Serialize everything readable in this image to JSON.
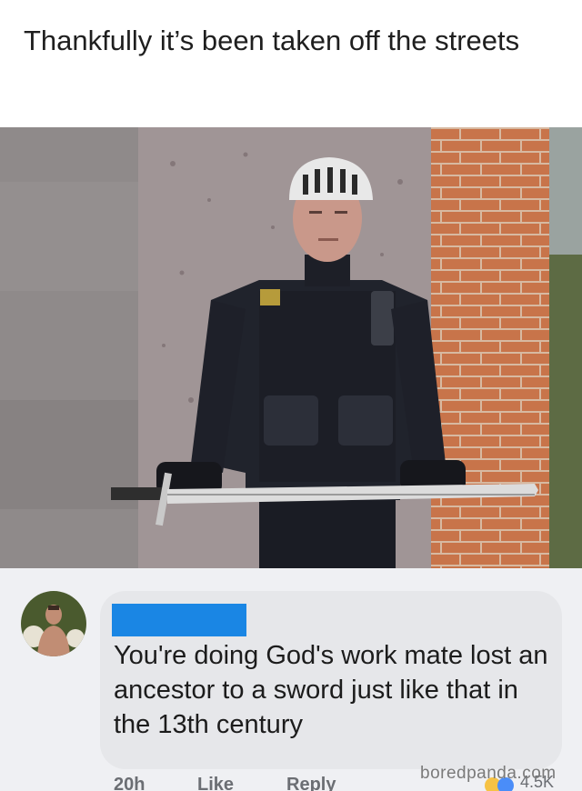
{
  "caption": "Thankfully it’s been taken off the streets",
  "comment": {
    "text": "You're doing God's work mate lost an ancestor to a sword just like that in the 13th century",
    "time": "20h",
    "like": "Like",
    "reply": "Reply",
    "reaction_count": "4.5K"
  },
  "watermark": "boredpanda.com",
  "colors": {
    "redaction": "#1a86e4",
    "comment_bubble": "#e6e7ea",
    "comment_area": "#eff0f3"
  },
  "icons": {
    "avatar": "avatar",
    "reactions": "reaction-icons"
  }
}
